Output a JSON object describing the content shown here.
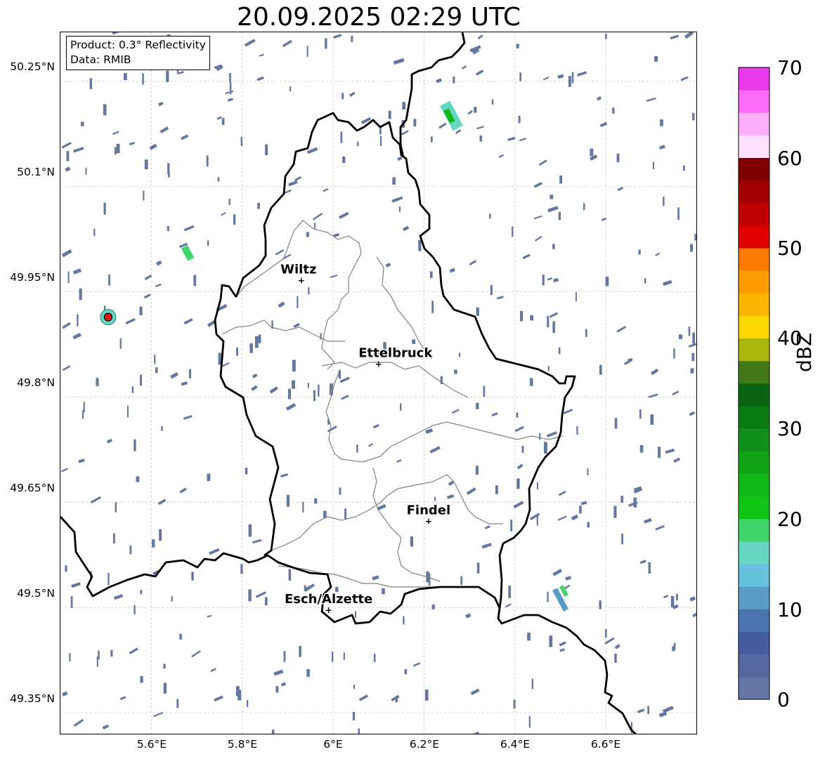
{
  "title": "20.09.2025 02:29 UTC",
  "info": {
    "product": "Product: 0.3° Reflectivity",
    "data": "Data: RMIB"
  },
  "lat_labels": [
    "50.25°N",
    "50.1°N",
    "49.95°N",
    "49.8°N",
    "49.65°N",
    "49.5°N",
    "49.35°N"
  ],
  "lon_labels": [
    "5.6°E",
    "5.8°E",
    "6°E",
    "6.2°E",
    "6.4°E",
    "6.6°E"
  ],
  "cities": [
    {
      "name": "Wiltz",
      "lon": 5.93,
      "lat": 49.966
    },
    {
      "name": "Ettelbruck",
      "lon": 6.1,
      "lat": 49.847
    },
    {
      "name": "Findel",
      "lon": 6.21,
      "lat": 49.623
    },
    {
      "name": "Esch/Alzette",
      "lon": 5.99,
      "lat": 49.496
    }
  ],
  "radar_site": {
    "lon": 5.505,
    "lat": 49.914,
    "color": "#e41a1c"
  },
  "colorbar": {
    "label": "dBZ",
    "ticks": [
      "0",
      "10",
      "20",
      "30",
      "40",
      "50",
      "60",
      "70"
    ],
    "min": 0,
    "max": 70,
    "colors": [
      "#6475a6",
      "#55689f",
      "#445c9f",
      "#4a74ad",
      "#5a9cc6",
      "#66c2dc",
      "#66d6c2",
      "#40d46a",
      "#10c416",
      "#10b816",
      "#10a416",
      "#10901a",
      "#0a7a12",
      "#0a6412",
      "#427816",
      "#aab60a",
      "#fcd600",
      "#fcb400",
      "#fc9c00",
      "#fc7a00",
      "#e00000",
      "#c00000",
      "#a00000",
      "#800000",
      "#ffe0fc",
      "#ffaefc",
      "#fc6af8",
      "#e83ae8"
    ]
  },
  "colors": {
    "border": "#000000",
    "canton": "#808080",
    "grid": "#c8c8c8",
    "low_echo": "#64779f"
  }
}
